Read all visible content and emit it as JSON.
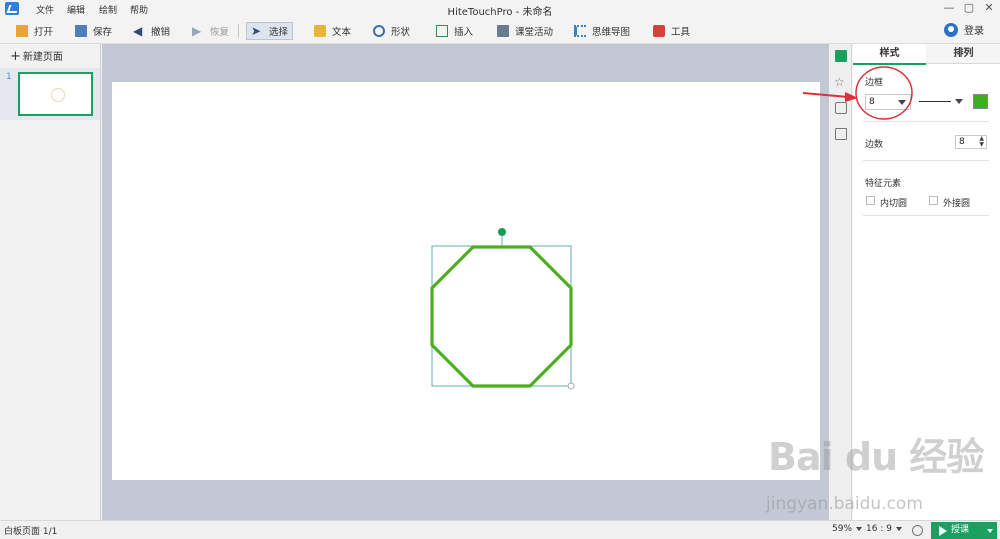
{
  "menu": [
    "文件",
    "编辑",
    "绘制",
    "帮助"
  ],
  "window_title": "HiteTouchPro - 未命名",
  "window_controls": [
    "minimize-icon",
    "maximize-icon",
    "close-icon"
  ],
  "toolbar": {
    "open": "打开",
    "save": "保存",
    "undo": "撤销",
    "redo": "恢复",
    "select": "选择",
    "text": "文本",
    "shape": "形状",
    "insert": "插入",
    "activity": "课堂活动",
    "mindmap": "思维导图",
    "tools": "工具",
    "login": "登录"
  },
  "pages_panel": {
    "new_page": "新建页面",
    "page_number": "1"
  },
  "properties": {
    "tabs": [
      "样式",
      "排列"
    ],
    "border_label": "边框",
    "border_width": "8",
    "border_color": "#3bb01b",
    "sides_label": "边数",
    "sides_value": "8",
    "feature_label": "特征元素",
    "inscribed_circle": "内切圆",
    "circumscribed_circle": "外接圆"
  },
  "shape": {
    "type": "octagon",
    "stroke_color": "#4caf20",
    "selection_color": "#3c9aa0",
    "handle_color": "#1a9a55"
  },
  "statusbar": {
    "page_info": "白板页面 1/1",
    "zoom": "59%",
    "ratio": "16 : 9",
    "present": "授课"
  },
  "watermark": {
    "main": "Bai du 经验",
    "sub": "jingyan.baidu.com"
  },
  "annotation_color": "#d9303a"
}
